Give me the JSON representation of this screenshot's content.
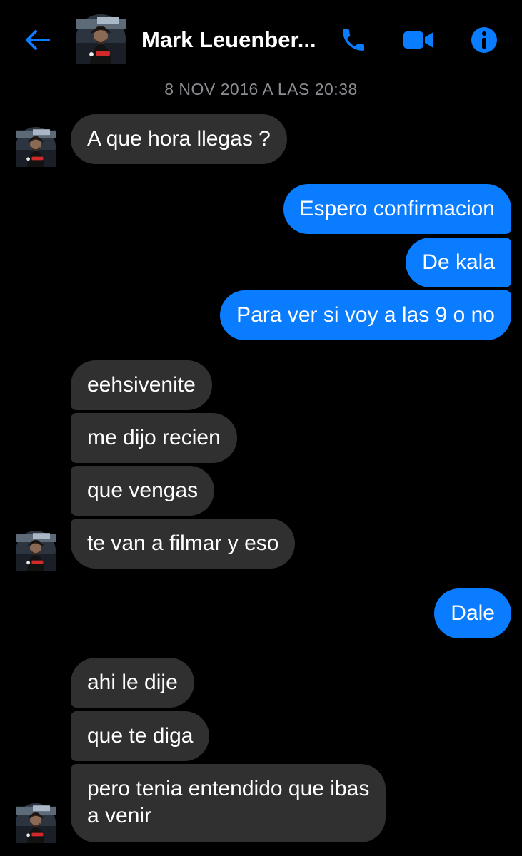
{
  "header": {
    "back_icon": "arrow-left-icon",
    "contact_name": "Mark Leuenber...",
    "actions": [
      "phone-icon",
      "video-camera-icon",
      "info-icon"
    ]
  },
  "timestamp": "8 NOV 2016 A LAS 20:38",
  "colors": {
    "accent": "#0a7cff",
    "background": "#000000",
    "incoming_bubble": "#303030",
    "timestamp": "#8a8d91"
  },
  "messages": [
    {
      "side": "in",
      "text": "A que hora llegas ?"
    },
    {
      "side": "out",
      "text": "Espero confirmacion"
    },
    {
      "side": "out",
      "text": "De kala"
    },
    {
      "side": "out",
      "text": "Para ver si voy a las 9 o no"
    },
    {
      "side": "in",
      "text": "eehsivenite"
    },
    {
      "side": "in",
      "text": "me dijo recien"
    },
    {
      "side": "in",
      "text": "que vengas"
    },
    {
      "side": "in",
      "text": "te van a filmar y eso"
    },
    {
      "side": "out",
      "text": "Dale"
    },
    {
      "side": "in",
      "text": "ahi le dije"
    },
    {
      "side": "in",
      "text": "que te diga"
    },
    {
      "side": "in",
      "text": "pero tenia entendido que ibas",
      "text2": "a venir"
    }
  ]
}
